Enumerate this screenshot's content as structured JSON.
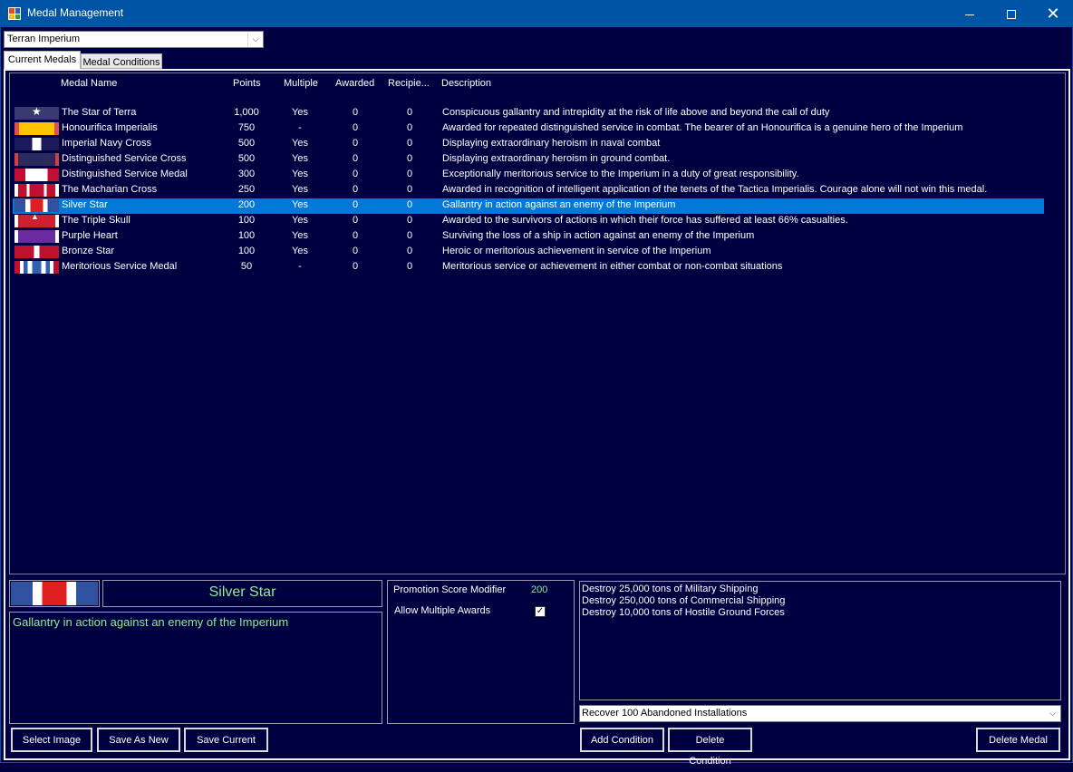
{
  "window": {
    "title": "Medal Management"
  },
  "race_select": {
    "value": "Terran Imperium"
  },
  "tabs": [
    {
      "label": "Current Medals"
    },
    {
      "label": "Medal Conditions"
    }
  ],
  "columns": {
    "name": "Medal Name",
    "points": "Points",
    "multiple": "Multiple",
    "awarded": "Awarded",
    "recipients": "Recipie...",
    "description": "Description"
  },
  "medals": [
    {
      "name": "The Star of Terra",
      "points": "1,000",
      "multiple": "Yes",
      "awarded": "0",
      "recipients": "0",
      "description": "Conspicuous gallantry and intrepidity at the risk of life above and beyond the call of duty",
      "ribbon": "star-of-terra"
    },
    {
      "name": "Honourifica Imperialis",
      "points": "750",
      "multiple": "-",
      "awarded": "0",
      "recipients": "0",
      "description": "Awarded for repeated distinguished service in combat. The bearer of an Honourifica is a genuine hero of the Imperium",
      "ribbon": "honourifica"
    },
    {
      "name": "Imperial Navy Cross",
      "points": "500",
      "multiple": "Yes",
      "awarded": "0",
      "recipients": "0",
      "description": "Displaying extraordinary heroism in naval combat",
      "ribbon": "navy-cross"
    },
    {
      "name": "Distinguished Service Cross",
      "points": "500",
      "multiple": "Yes",
      "awarded": "0",
      "recipients": "0",
      "description": "Displaying extraordinary heroism in ground combat.",
      "ribbon": "dsc"
    },
    {
      "name": "Distinguished Service Medal",
      "points": "300",
      "multiple": "Yes",
      "awarded": "0",
      "recipients": "0",
      "description": "Exceptionally meritorious service to the Imperium in a duty of great responsibility.",
      "ribbon": "dsm"
    },
    {
      "name": "The Macharian Cross",
      "points": "250",
      "multiple": "Yes",
      "awarded": "0",
      "recipients": "0",
      "description": "Awarded in recognition of intelligent application of the tenets of the Tactica Imperialis. Courage alone will not win this medal.",
      "ribbon": "macharian"
    },
    {
      "name": "Silver Star",
      "points": "200",
      "multiple": "Yes",
      "awarded": "0",
      "recipients": "0",
      "description": "Gallantry in action against an enemy of the Imperium",
      "ribbon": "silver-star",
      "selected": true
    },
    {
      "name": "The Triple Skull",
      "points": "100",
      "multiple": "Yes",
      "awarded": "0",
      "recipients": "0",
      "description": "Awarded to the survivors of actions in which their force has suffered at least 66% casualties.",
      "ribbon": "triple-skull"
    },
    {
      "name": "Purple Heart",
      "points": "100",
      "multiple": "Yes",
      "awarded": "0",
      "recipients": "0",
      "description": "Surviving the loss of a ship in action against an enemy of the Imperium",
      "ribbon": "purple-heart"
    },
    {
      "name": "Bronze Star",
      "points": "100",
      "multiple": "Yes",
      "awarded": "0",
      "recipients": "0",
      "description": "Heroic or meritorious achievement in service of the Imperium",
      "ribbon": "bronze-star"
    },
    {
      "name": "Meritorious Service Medal",
      "points": "50",
      "multiple": "-",
      "awarded": "0",
      "recipients": "0",
      "description": "Meritorious service or achievement in either combat or non-combat situations",
      "ribbon": "msm"
    }
  ],
  "detail": {
    "name": "Silver Star",
    "description": "Gallantry in action against an enemy of the Imperium",
    "promotion_label": "Promotion Score Modifier",
    "promotion_value": "200",
    "multiple_label": "Allow Multiple Awards",
    "multiple_checked": true
  },
  "conditions": [
    "Destroy 25,000 tons of Military Shipping",
    "Destroy 250,000 tons of Commercial Shipping",
    "Destroy 10,000 tons of Hostile Ground Forces"
  ],
  "condition_select": {
    "value": "Recover 100 Abandoned Installations"
  },
  "buttons": {
    "select_image": "Select Image",
    "save_as_new": "Save As New",
    "save_current": "Save Current",
    "add_condition": "Add Condition",
    "delete_condition": "Delete Condition",
    "delete_medal": "Delete Medal"
  },
  "colors": {
    "background": "#000040",
    "selection": "#0078d7",
    "accent_text": "#90ee90",
    "titlebar": "#0054a6"
  }
}
